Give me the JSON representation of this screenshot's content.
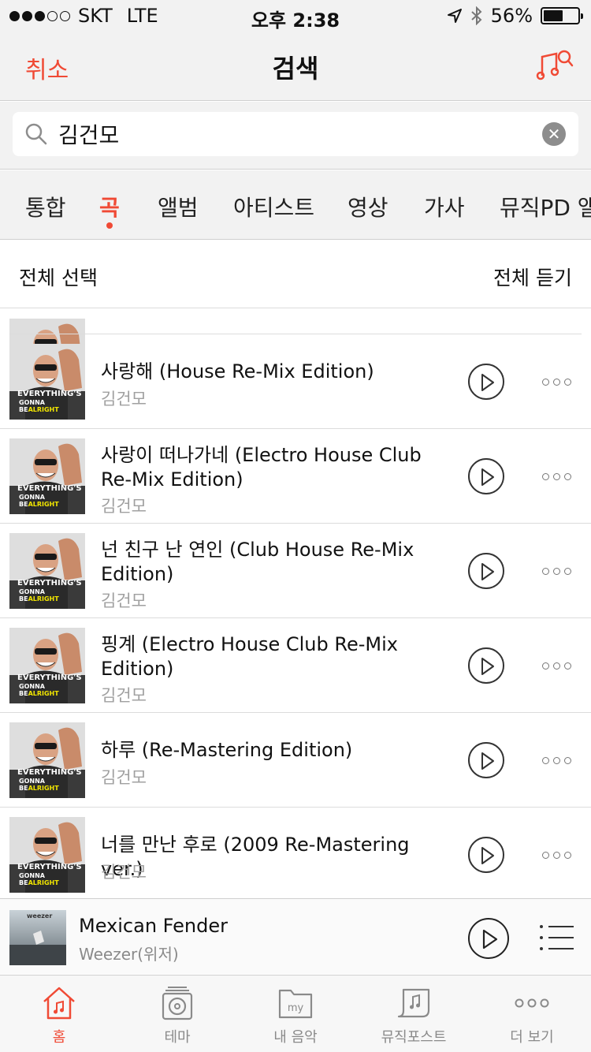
{
  "status_bar": {
    "carrier": "SKT",
    "network": "LTE",
    "time": "오후 2:38",
    "battery": "56%",
    "battery_level": 0.56,
    "signal_bars": 3
  },
  "nav": {
    "cancel_label": "취소",
    "title": "검색",
    "accent_color": "#f04a35"
  },
  "search": {
    "value": "김건모",
    "placeholder": ""
  },
  "tabs": [
    {
      "label": "통합",
      "active": false
    },
    {
      "label": "곡",
      "active": true
    },
    {
      "label": "앨범",
      "active": false
    },
    {
      "label": "아티스트",
      "active": false
    },
    {
      "label": "영상",
      "active": false
    },
    {
      "label": "가사",
      "active": false
    },
    {
      "label": "뮤직PD 앨범",
      "active": false
    }
  ],
  "list_header": {
    "select_all": "전체 선택",
    "play_all": "전체 듣기"
  },
  "songs": [
    {
      "title": "사랑해 (House Re-Mix Edition)",
      "artist": "김건모"
    },
    {
      "title": "사랑이 떠나가네 (Electro House Club Re-Mix Edition)",
      "artist": "김건모"
    },
    {
      "title": "넌 친구 난 연인 (Club House Re-Mix Edition)",
      "artist": "김건모"
    },
    {
      "title": "핑계 (Electro House Club Re-Mix Edition)",
      "artist": "김건모"
    },
    {
      "title": "하루 (Re-Mastering Edition)",
      "artist": "김건모"
    },
    {
      "title": "너를 만난 후로 (2009 Re-Mastering ver.)",
      "artist": "김건모"
    }
  ],
  "album_art": {
    "line1": "EVERYTHING'S",
    "line2": "GONNA BE",
    "line3": "ALRIGHT"
  },
  "now_playing": {
    "title": "Mexican Fender",
    "artist": "Weezer(위저)",
    "cover_text": "weezer"
  },
  "tab_bar": [
    {
      "label": "홈",
      "icon": "home-music-icon",
      "active": true
    },
    {
      "label": "테마",
      "icon": "record-player-icon",
      "active": false
    },
    {
      "label": "내 음악",
      "icon": "my-folder-icon",
      "active": false
    },
    {
      "label": "뮤직포스트",
      "icon": "music-post-icon",
      "active": false
    },
    {
      "label": "더 보기",
      "icon": "more-dots-icon",
      "active": false
    }
  ]
}
